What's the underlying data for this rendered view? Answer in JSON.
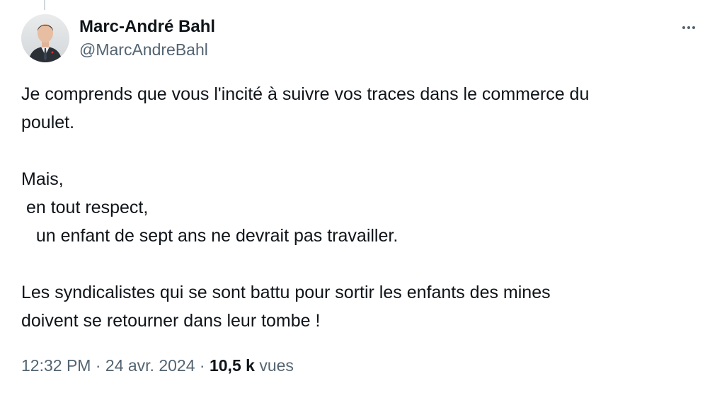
{
  "tweet": {
    "author": {
      "display_name": "Marc-André Bahl",
      "handle": "@MarcAndreBahl"
    },
    "more_icon": "more-horizontal-icon",
    "text_lines": [
      "Je comprends que vous l'incité à suivre vos traces dans le commerce du",
      "poulet.",
      "",
      "Mais,",
      " en tout respect,",
      "   un enfant de sept ans ne devrait pas travailler.",
      "",
      "Les syndicalistes qui se sont battu pour sortir les enfants des mines",
      "doivent se retourner dans leur tombe !"
    ],
    "time": "12:32 PM",
    "separator": " · ",
    "date": "24 avr. 2024",
    "views_count": "10,5 k",
    "views_label": "vues"
  },
  "colors": {
    "text_primary": "#0f1419",
    "text_secondary": "#536471",
    "thread_line": "#cfd9de",
    "background": "#ffffff"
  }
}
